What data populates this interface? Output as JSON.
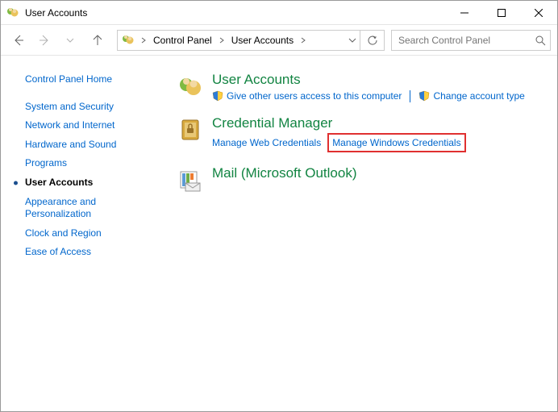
{
  "window": {
    "title": "User Accounts"
  },
  "breadcrumb": {
    "items": [
      "Control Panel",
      "User Accounts"
    ]
  },
  "search": {
    "placeholder": "Search Control Panel"
  },
  "sidebar": {
    "home": "Control Panel Home",
    "items": [
      "System and Security",
      "Network and Internet",
      "Hardware and Sound",
      "Programs",
      "User Accounts",
      "Appearance and Personalization",
      "Clock and Region",
      "Ease of Access"
    ]
  },
  "main": {
    "user_accounts": {
      "title": "User Accounts",
      "link1": "Give other users access to this computer",
      "link2": "Change account type"
    },
    "credential_manager": {
      "title": "Credential Manager",
      "link1": "Manage Web Credentials",
      "link2": "Manage Windows Credentials"
    },
    "mail": {
      "title": "Mail (Microsoft Outlook)"
    }
  }
}
